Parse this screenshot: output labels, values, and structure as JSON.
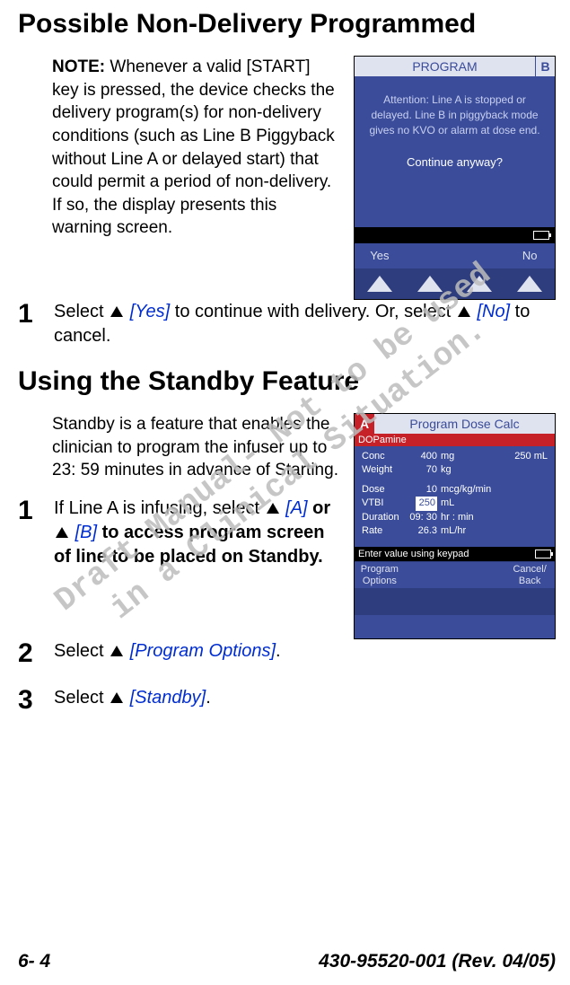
{
  "watermark": {
    "line1": "Draft Manual- Not to be used",
    "line2": "in a Clinical Situation."
  },
  "heading1": "Possible Non-Delivery Programmed",
  "note": {
    "prefix": "NOTE: ",
    "body": "Whenever a valid [START] key is pressed, the device checks the delivery program(s) for non-delivery conditions (such as Line B Piggyback without Line A or delayed start) that could permit a period of non-delivery. If so, the display presents this warning screen."
  },
  "s1_step1": {
    "num": "1",
    "pre": "Select ",
    "yes": "[Yes]",
    "mid": " to continue with delivery. Or, select ",
    "no": "[No]",
    "post": " to cancel."
  },
  "heading2": "Using the Standby Feature",
  "standby_intro": "Standby is a feature that enables the clinician to program the infuser up to 23: 59 minutes in advance of Starting.",
  "s2_step1": {
    "num": "1",
    "pre": "If Line A is infusing, select ",
    "a": "[A]",
    "or": " or ",
    "b": "[B]",
    "post": " to access program screen of line to be placed on Standby."
  },
  "s2_step2": {
    "num": "2",
    "pre": "Select ",
    "ref": "[Program Options]",
    "post": "."
  },
  "s2_step3": {
    "num": "3",
    "pre": "Select ",
    "ref": "[Standby]",
    "post": "."
  },
  "device1": {
    "title": "PROGRAM",
    "badge": "B",
    "msg_l1": "Attention: Line A is stopped or",
    "msg_l2": "delayed. Line B in piggyback mode",
    "msg_l3": "gives no KVO or alarm at dose end.",
    "continue": "Continue anyway?",
    "soft_yes": "Yes",
    "soft_no": "No"
  },
  "device2": {
    "badge": "A",
    "title": "Program Dose Calc",
    "drug": "DOPamine",
    "rows": {
      "conc": {
        "l": "Conc",
        "v": "400",
        "u": "mg",
        "r": "250 mL"
      },
      "weight": {
        "l": "Weight",
        "v": "70",
        "u": "kg",
        "r": ""
      },
      "dose": {
        "l": "Dose",
        "v": "10",
        "u": "mcg/kg/min"
      },
      "vtbi": {
        "l": "VTBI",
        "v": "250",
        "u": "mL"
      },
      "duration": {
        "l": "Duration",
        "v": "09: 30",
        "u": "hr : min"
      },
      "rate": {
        "l": "Rate",
        "v": "26.3",
        "u": "mL/hr"
      }
    },
    "enter": "Enter value using keypad",
    "soft_prog1": "Program",
    "soft_prog2": "Options",
    "soft_cancel1": "Cancel/",
    "soft_cancel2": "Back"
  },
  "footer": {
    "page": "6- 4",
    "doc": "430-95520-001 (Rev. 04/05)"
  }
}
